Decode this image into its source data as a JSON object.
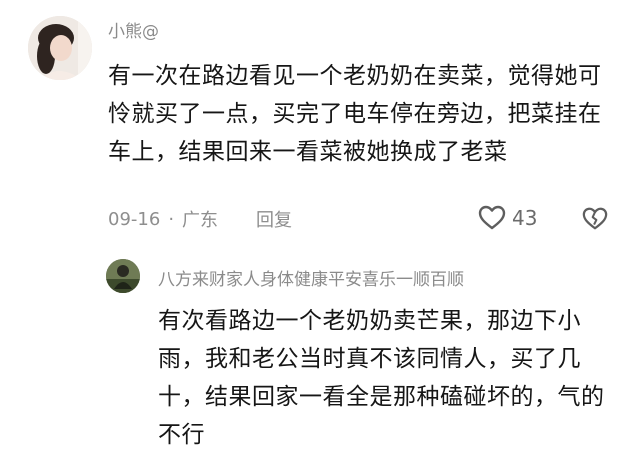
{
  "comment": {
    "username": "小熊@",
    "text": "有一次在路边看见一个老奶奶在卖菜，觉得她可怜就买了一点，买完了电车停在旁边，把菜挂在车上，结果回来一看菜被她换成了老菜",
    "date": "09-16",
    "separator": "·",
    "location": "广东",
    "reply_label": "回复",
    "like_count": "43",
    "icons": {
      "like": "heart-outline-icon",
      "dislike": "broken-heart-icon"
    }
  },
  "reply": {
    "username": "八方来财家人身体健康平安喜乐一顺百顺",
    "text": "有次看路边一个老奶奶卖芒果，那边下小雨，我和老公当时真不该同情人，买了几十，结果回家一看全是那种磕碰坏的，气的不行"
  }
}
